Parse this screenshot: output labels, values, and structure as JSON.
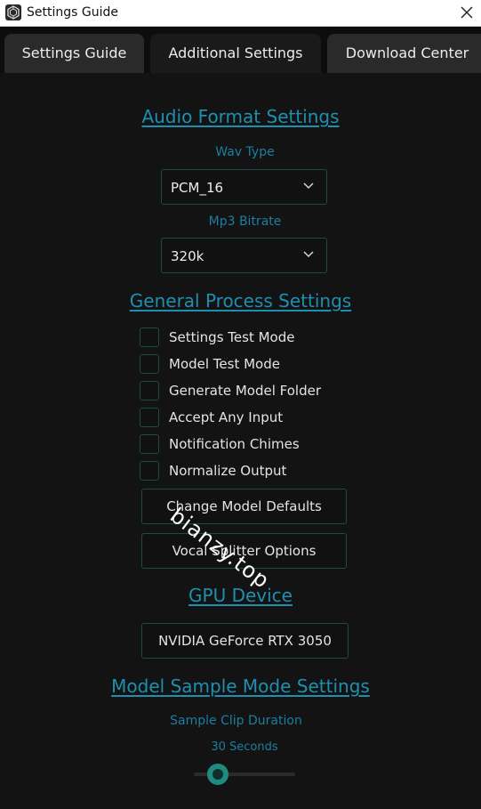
{
  "window": {
    "title": "Settings Guide",
    "icon": "app-logo-icon",
    "close_icon": "close-icon"
  },
  "tabs": [
    {
      "label": "Settings Guide",
      "active": false
    },
    {
      "label": "Additional Settings",
      "active": true
    },
    {
      "label": "Download Center",
      "active": false
    }
  ],
  "audio_format": {
    "title": "Audio Format Settings",
    "wav_type_label": "Wav Type",
    "wav_type_value": "PCM_16",
    "mp3_bitrate_label": "Mp3 Bitrate",
    "mp3_bitrate_value": "320k"
  },
  "general_process": {
    "title": "General Process Settings",
    "checkboxes": [
      {
        "label": "Settings Test Mode",
        "checked": false
      },
      {
        "label": "Model Test Mode",
        "checked": false
      },
      {
        "label": "Generate Model Folder",
        "checked": false
      },
      {
        "label": "Accept Any Input",
        "checked": false
      },
      {
        "label": "Notification Chimes",
        "checked": false
      },
      {
        "label": "Normalize Output",
        "checked": false
      }
    ],
    "buttons": [
      {
        "label": "Change Model Defaults"
      },
      {
        "label": "Vocal Splitter Options"
      }
    ]
  },
  "gpu": {
    "title": "GPU Device",
    "device": "NVIDIA GeForce RTX 3050"
  },
  "sample_mode": {
    "title": "Model Sample Mode Settings",
    "clip_duration_label": "Sample Clip Duration",
    "clip_duration_value": "30 Seconds"
  },
  "watermark": "bianzy.top",
  "colors": {
    "accent": "#1f8fb0",
    "border": "#1f4a45",
    "slider_handle": "#1e8a80",
    "background": "#131313"
  }
}
